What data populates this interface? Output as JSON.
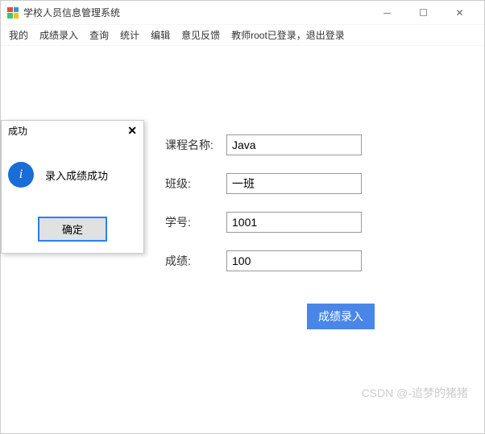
{
  "titlebar": {
    "title": "学校人员信息管理系统"
  },
  "menubar": {
    "items": [
      "我的",
      "成绩录入",
      "查询",
      "统计",
      "编辑",
      "意见反馈",
      "教师root已登录，退出登录"
    ]
  },
  "form": {
    "course_label": "课程名称:",
    "course_value": "Java",
    "class_label": "班级:",
    "class_value": "一班",
    "id_label": "学号:",
    "id_value": "1001",
    "score_label": "成绩:",
    "score_value": "100",
    "submit_label": "成绩录入"
  },
  "dialog": {
    "title": "成功",
    "message": "录入成绩成功",
    "ok_label": "确定"
  },
  "watermark": "CSDN @-追梦的猪猪"
}
